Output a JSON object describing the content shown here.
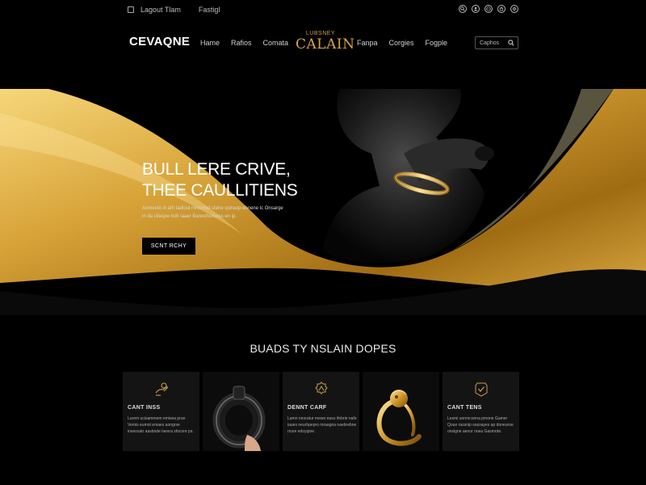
{
  "topbar": {
    "left_items": [
      "Lagout Tlam",
      "Fastigl"
    ],
    "right_icons": [
      "search-icon",
      "user-icon",
      "globe-icon",
      "bag-icon",
      "gear-icon"
    ]
  },
  "header": {
    "logo": "CEVAQNE",
    "nav_left": [
      "Hame",
      "Rafios",
      "Comata"
    ],
    "brand_top": "LUBSNEY",
    "brand_main": "CALAIN",
    "nav_right": [
      "Fanpa",
      "Corgies",
      "Fogple"
    ],
    "search_placeholder": "Caphos"
  },
  "hero": {
    "title_line1": "BULL LERE CRIVE,",
    "title_line2": "THEE CAULLITIENS",
    "subtitle": "Anmeotit in ath tadioul mrocrind stehe qstraop ebnene lc Onsarge in da ctlaspe hofr laaer Baresthcrhoss en ip.",
    "button_label": "SCNT RCHY"
  },
  "section": {
    "title": "BUADS TY NSLAIN DOPES"
  },
  "cards": [
    {
      "type": "text",
      "icon": "ring-hand-icon",
      "title": "CANT INSS",
      "text": "Lurem ucisammem emisea pran Vemis eumot emaes aongrse inseosatr aasbode laesra sfocore ps."
    },
    {
      "type": "image",
      "art": "black-hoop-earring-image"
    },
    {
      "type": "text",
      "icon": "sparkle-badge-icon",
      "title": "DENNT CARF",
      "text": "Lamn nnoratur mewo easu ifebrie nafe iaues neurhpepro mraagna naebrebne rnsre edoyqine."
    },
    {
      "type": "image",
      "art": "gold-lion-ring-image"
    },
    {
      "type": "text",
      "icon": "check-badge-icon",
      "title": "CANT TENS",
      "text": "Lesmi uonmconna pmone Gamer Qoue rassnip oassayes ap doneuroe onsigne aenor noea Gasmrde."
    }
  ],
  "colors": {
    "gold": "#d6a33b",
    "gold_light": "#f3cf6e",
    "background": "#000000",
    "card_bg": "#141414"
  }
}
